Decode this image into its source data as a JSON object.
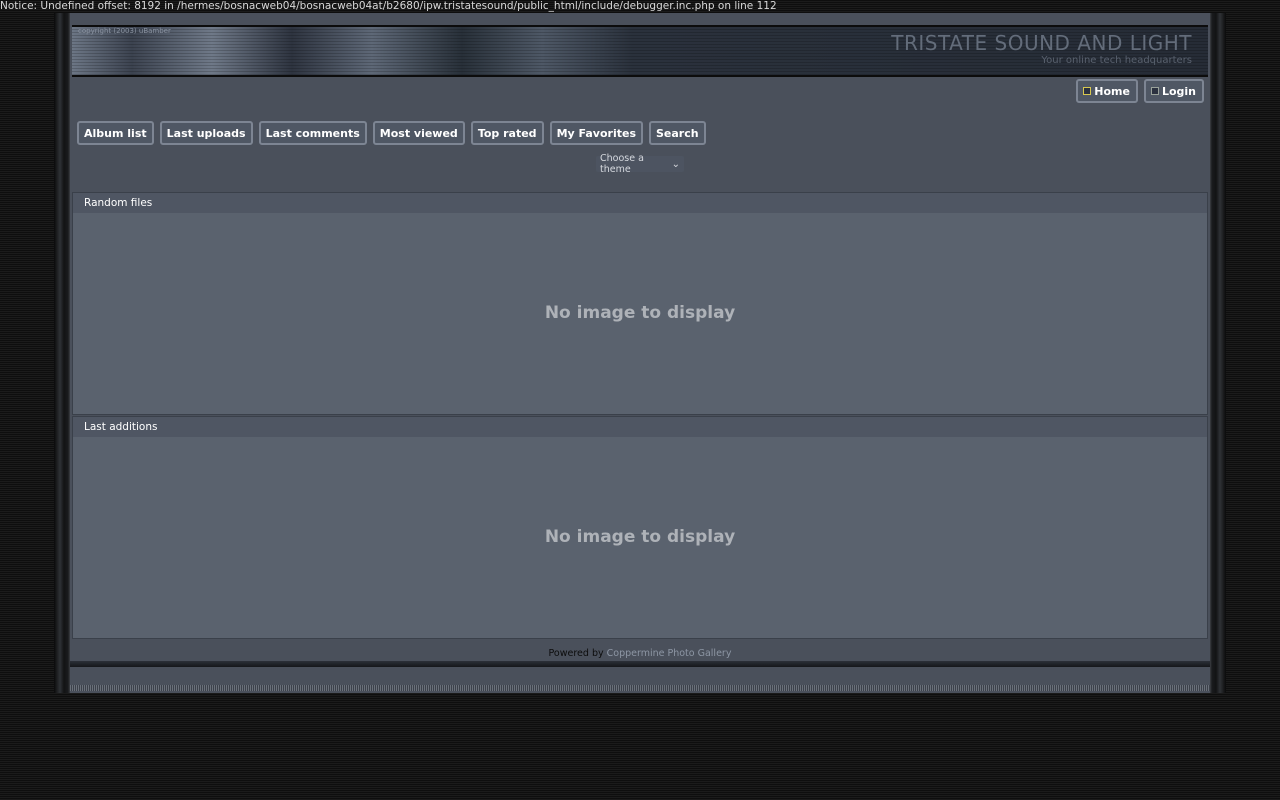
{
  "notice": "Notice: Undefined offset: 8192 in /hermes/bosnacweb04/bosnacweb04at/b2680/ipw.tristatesound/public_html/include/debugger.inc.php on line 112",
  "banner": {
    "title": "TRISTATE SOUND AND LIGHT",
    "subtitle": "Your online tech headquarters",
    "copyright": "copyright (2003) uBamber"
  },
  "topnav": {
    "home": "Home",
    "login": "Login"
  },
  "menu": [
    "Album list",
    "Last uploads",
    "Last comments",
    "Most viewed",
    "Top rated",
    "My Favorites",
    "Search"
  ],
  "theme_selector": {
    "label": "Choose a theme"
  },
  "sections": [
    {
      "title": "Random files",
      "message": "No image to display"
    },
    {
      "title": "Last additions",
      "message": "No image to display"
    }
  ],
  "footer": {
    "prefix": "Powered by",
    "link": "Coppermine Photo Gallery"
  },
  "colors": {
    "page_bg": "#141414",
    "panel_bg": "#4a505b",
    "section_bg": "#5a626e",
    "button_border": "#7d8593",
    "message_text": "#aeb2b8"
  }
}
